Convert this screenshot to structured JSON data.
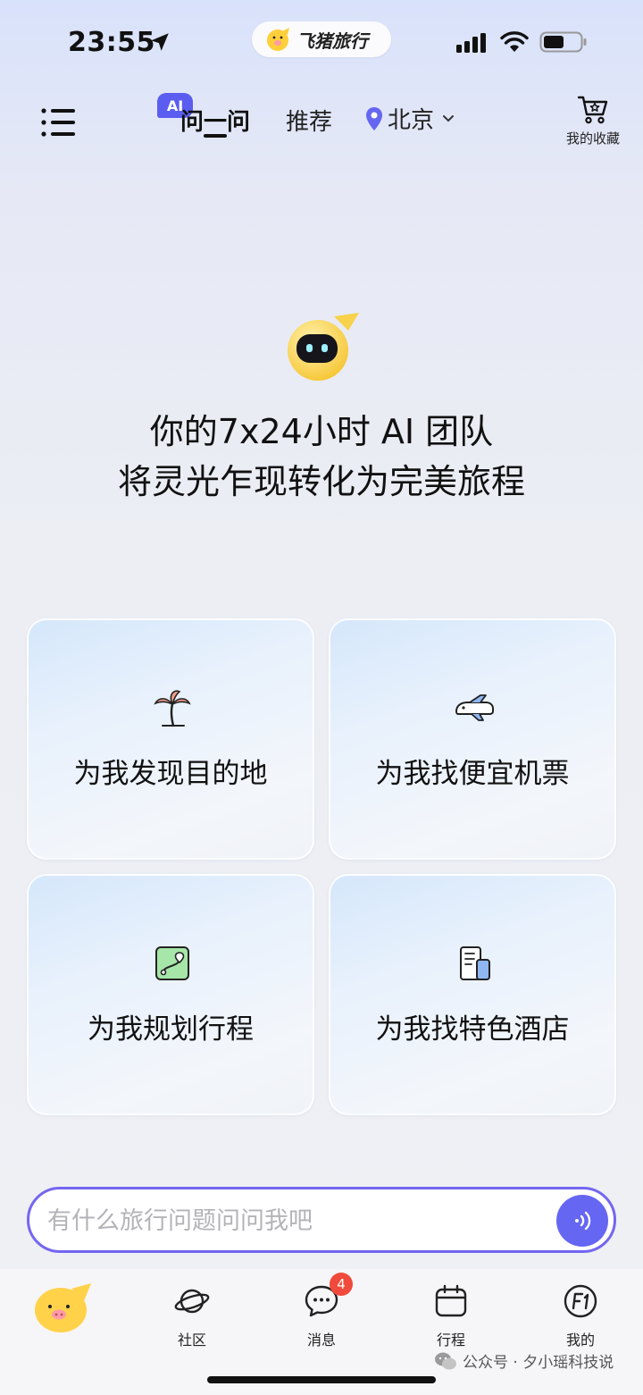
{
  "status_bar": {
    "time": "23:55",
    "brand_pill": "飞猪旅行",
    "icons": [
      "location-arrow-icon",
      "cellular-signal-icon",
      "wifi-icon",
      "battery-icon"
    ]
  },
  "header": {
    "menu_icon": "menu-icon",
    "ai_badge": "AI",
    "tabs": [
      {
        "label": "问一问",
        "active": true
      },
      {
        "label": "推荐",
        "active": false
      }
    ],
    "city": "北京",
    "favorites_label": "我的收藏"
  },
  "hero": {
    "line1": "你的7x24小时 AI 团队",
    "line2": "将灵光乍现转化为完美旅程"
  },
  "cards": [
    {
      "label": "为我发现目的地",
      "icon": "palm-tree-icon"
    },
    {
      "label": "为我找便宜机票",
      "icon": "plane-icon"
    },
    {
      "label": "为我规划行程",
      "icon": "map-route-icon"
    },
    {
      "label": "为我找特色酒店",
      "icon": "hotel-building-icon"
    }
  ],
  "search": {
    "placeholder": "有什么旅行问题问问我吧",
    "value": ""
  },
  "tabbar": {
    "items": [
      {
        "label": "",
        "icon": "fliggy-pig-icon"
      },
      {
        "label": "社区",
        "icon": "planet-icon"
      },
      {
        "label": "消息",
        "icon": "chat-bubble-icon",
        "badge": "4"
      },
      {
        "label": "行程",
        "icon": "calendar-icon"
      },
      {
        "label": "我的",
        "icon": "profile-f1-icon"
      }
    ]
  },
  "watermark": "公众号 · 夕小瑶科技说",
  "colors": {
    "accent": "#6566f2",
    "input_border": "#7466f1",
    "badge": "#f04a3c",
    "brand_yellow": "#ffd24a"
  }
}
